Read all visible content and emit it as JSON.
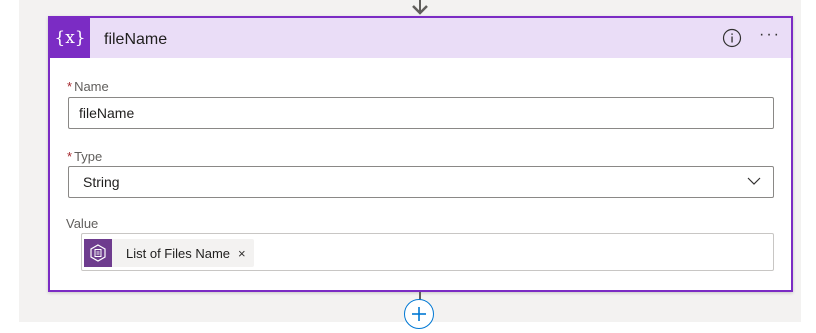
{
  "action_card": {
    "title": "fileName",
    "icon_text": "{x}",
    "icon": "variable-icon",
    "accent_color": "#7b2cc4",
    "header_color": "#eaddf7",
    "info_icon": "info-icon",
    "more_icon": "ellipsis-icon",
    "more_label": "···"
  },
  "fields": {
    "name": {
      "required_mark": "*",
      "label": "Name",
      "value": "fileName"
    },
    "type": {
      "required_mark": "*",
      "label": "Type",
      "selected": "String",
      "icon": "chevron-down-icon"
    },
    "value": {
      "label": "Value",
      "token": {
        "label": "List of Files Name",
        "remove_label": "×",
        "icon": "sharepoint-file-icon",
        "icon_color": "#6e3c8e"
      }
    }
  },
  "flow": {
    "add_button_icon": "plus-icon",
    "connector_color": "#605e5c",
    "add_color": "#0078d4"
  }
}
